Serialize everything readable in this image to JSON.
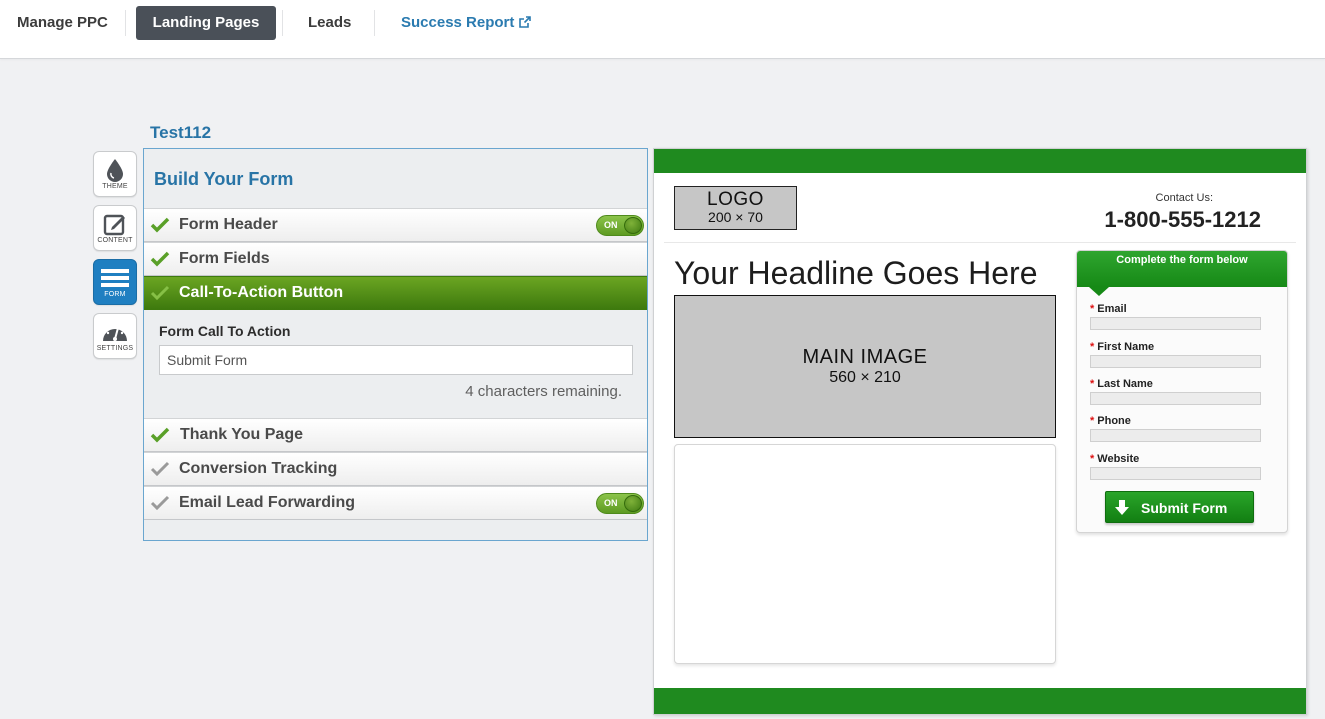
{
  "nav": {
    "items": [
      {
        "label": "Manage PPC"
      },
      {
        "label": "Landing Pages"
      },
      {
        "label": "Leads"
      },
      {
        "label": "Success Report"
      }
    ]
  },
  "project": {
    "title": "Test112"
  },
  "tools": [
    {
      "label": "THEME",
      "icon": "droplet-icon"
    },
    {
      "label": "CONTENT",
      "icon": "edit-icon"
    },
    {
      "label": "FORM",
      "icon": "list-icon"
    },
    {
      "label": "SETTINGS",
      "icon": "gauge-icon"
    }
  ],
  "builder": {
    "title": "Build Your Form",
    "sections": [
      {
        "label": "Form Header",
        "toggle": "ON"
      },
      {
        "label": "Form Fields"
      },
      {
        "label": "Call-To-Action Button"
      },
      {
        "label": "Thank You Page"
      },
      {
        "label": "Conversion Tracking"
      },
      {
        "label": "Email Lead Forwarding",
        "toggle": "ON"
      }
    ],
    "cta": {
      "field_label": "Form Call To Action",
      "value": "Submit Form",
      "remaining": "4 characters remaining."
    }
  },
  "preview": {
    "logo": {
      "label": "LOGO",
      "size": "200 × 70"
    },
    "contact_label": "Contact Us:",
    "phone": "1-800-555-1212",
    "headline": "Your Headline Goes Here",
    "main_image": {
      "label": "MAIN IMAGE",
      "size": "560 × 210"
    },
    "form": {
      "header": "Complete the form below",
      "fields": [
        "Email",
        "First Name",
        "Last Name",
        "Phone",
        "Website"
      ],
      "required_mark": "*",
      "submit_label": "Submit Form"
    }
  },
  "colors": {
    "accent_blue": "#2874a6",
    "active_nav": "#4a5058",
    "active_section_green": "#4e8c16",
    "preview_green": "#1f8a1f"
  }
}
